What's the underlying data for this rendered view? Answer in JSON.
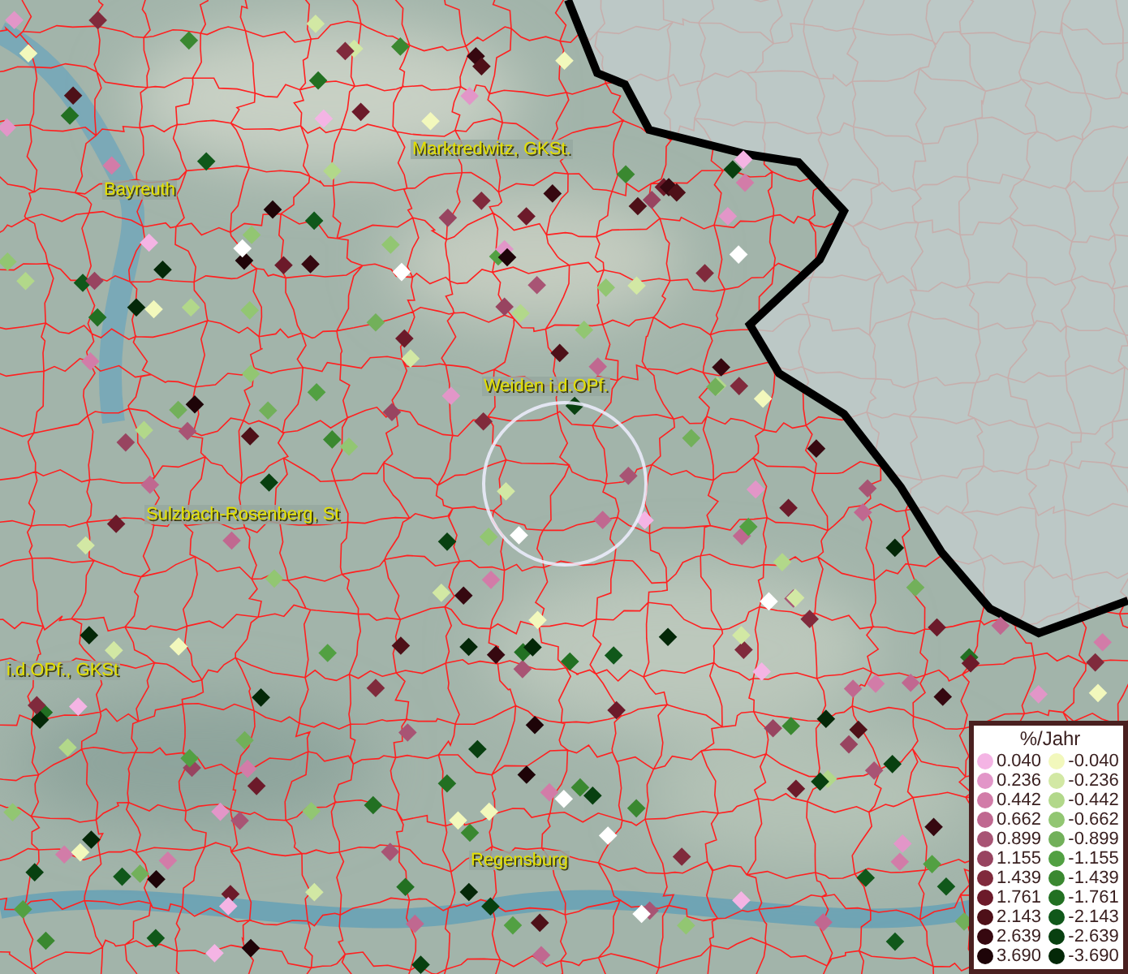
{
  "map": {
    "places": [
      {
        "name": "Marktredwitz, GKSt."
      },
      {
        "name": "Bayreuth"
      },
      {
        "name": "Weiden i.d.OPf."
      },
      {
        "name": "Sulzbach-Rosenberg, St"
      },
      {
        "name": "i.d.OPf., GKSt"
      },
      {
        "name": "Regensburg"
      }
    ]
  },
  "legend": {
    "title": "%/Jahr",
    "increase": [
      {
        "label": "0.040",
        "color": "#f4b4e4"
      },
      {
        "label": "0.236",
        "color": "#e296c8"
      },
      {
        "label": "0.442",
        "color": "#d27ca8"
      },
      {
        "label": "0.662",
        "color": "#c06890"
      },
      {
        "label": "0.899",
        "color": "#a85474"
      },
      {
        "label": "1.155",
        "color": "#984460"
      },
      {
        "label": "1.439",
        "color": "#802a3c"
      },
      {
        "label": "1.761",
        "color": "#6c1a2a"
      },
      {
        "label": "2.143",
        "color": "#4e1018"
      },
      {
        "label": "2.639",
        "color": "#360810"
      },
      {
        "label": "3.690",
        "color": "#1e0408"
      }
    ],
    "decrease": [
      {
        "label": "-0.040",
        "color": "#f2f8bc"
      },
      {
        "label": "-0.236",
        "color": "#d2e8a4"
      },
      {
        "label": "-0.442",
        "color": "#b2d88a"
      },
      {
        "label": "-0.662",
        "color": "#92c672"
      },
      {
        "label": "-0.899",
        "color": "#72b05a"
      },
      {
        "label": "-1.155",
        "color": "#52a042"
      },
      {
        "label": "-1.439",
        "color": "#3a8830"
      },
      {
        "label": "-1.761",
        "color": "#227022"
      },
      {
        "label": "-2.143",
        "color": "#10581a"
      },
      {
        "label": "-2.639",
        "color": "#084010"
      },
      {
        "label": "-3.690",
        "color": "#042808"
      }
    ]
  }
}
